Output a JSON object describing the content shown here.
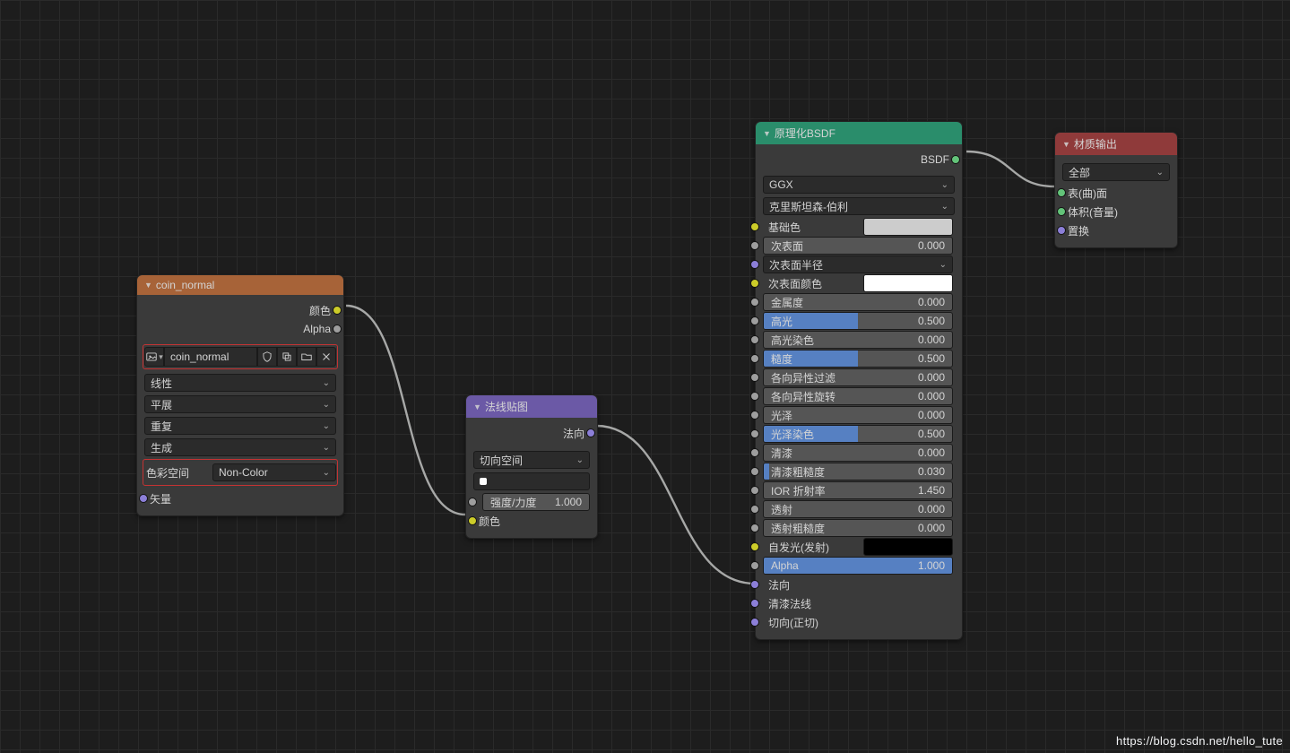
{
  "watermark": "https://blog.csdn.net/hello_tute",
  "imageTexture": {
    "title": "coin_normal",
    "outputs": {
      "color": "颜色",
      "alpha": "Alpha"
    },
    "image_name": "coin_normal",
    "interp": "线性",
    "projection": "平展",
    "extension": "重复",
    "source": "生成",
    "colorspace_label": "色彩空间",
    "colorspace_value": "Non-Color",
    "input_vector": "矢量"
  },
  "normalMap": {
    "title": "法线贴图",
    "output_normal": "法向",
    "space": "切向空间",
    "strength_label": "强度/力度",
    "strength_value": "1.000",
    "input_color": "颜色"
  },
  "bsdf": {
    "title": "原理化BSDF",
    "output": "BSDF",
    "distribution": "GGX",
    "subsurface_method": "克里斯坦森-伯利",
    "rows": [
      {
        "name": "base-color",
        "label": "基础色",
        "type": "swatch",
        "color": "#cccccc",
        "sock": "yellow"
      },
      {
        "name": "subsurface",
        "label": "次表面",
        "type": "value",
        "value": "0.000",
        "fill": 0,
        "sock": "grey"
      },
      {
        "name": "subsurface-radius",
        "label": "次表面半径",
        "type": "dropdown",
        "sock": "purple"
      },
      {
        "name": "subsurface-color",
        "label": "次表面颜色",
        "type": "swatch",
        "color": "#ffffff",
        "sock": "yellow"
      },
      {
        "name": "metallic",
        "label": "金属度",
        "type": "value",
        "value": "0.000",
        "fill": 0,
        "sock": "grey"
      },
      {
        "name": "specular",
        "label": "高光",
        "type": "value",
        "value": "0.500",
        "fill": 50,
        "sock": "grey"
      },
      {
        "name": "specular-tint",
        "label": "高光染色",
        "type": "value",
        "value": "0.000",
        "fill": 0,
        "sock": "grey"
      },
      {
        "name": "roughness",
        "label": "糙度",
        "type": "value",
        "value": "0.500",
        "fill": 50,
        "sock": "grey"
      },
      {
        "name": "anisotropic",
        "label": "各向异性过滤",
        "type": "value",
        "value": "0.000",
        "fill": 0,
        "sock": "grey"
      },
      {
        "name": "anisotropic-rot",
        "label": "各向异性旋转",
        "type": "value",
        "value": "0.000",
        "fill": 0,
        "sock": "grey"
      },
      {
        "name": "sheen",
        "label": "光泽",
        "type": "value",
        "value": "0.000",
        "fill": 0,
        "sock": "grey"
      },
      {
        "name": "sheen-tint",
        "label": "光泽染色",
        "type": "value",
        "value": "0.500",
        "fill": 50,
        "sock": "grey"
      },
      {
        "name": "clearcoat",
        "label": "清漆",
        "type": "value",
        "value": "0.000",
        "fill": 0,
        "sock": "grey"
      },
      {
        "name": "clearcoat-rough",
        "label": "清漆粗糙度",
        "type": "value",
        "value": "0.030",
        "fill": 3,
        "sock": "grey"
      },
      {
        "name": "ior",
        "label": "IOR 折射率",
        "type": "value",
        "value": "1.450",
        "fill": 0,
        "sock": "grey"
      },
      {
        "name": "transmission",
        "label": "透射",
        "type": "value",
        "value": "0.000",
        "fill": 0,
        "sock": "grey"
      },
      {
        "name": "transmission-rough",
        "label": "透射粗糙度",
        "type": "value",
        "value": "0.000",
        "fill": 0,
        "sock": "grey"
      },
      {
        "name": "emission",
        "label": "自发光(发射)",
        "type": "swatch",
        "color": "#000000",
        "sock": "yellow"
      },
      {
        "name": "alpha",
        "label": "Alpha",
        "type": "value",
        "value": "1.000",
        "fill": 100,
        "sock": "grey"
      },
      {
        "name": "normal",
        "label": "法向",
        "type": "input",
        "sock": "purple"
      },
      {
        "name": "clearcoat-normal",
        "label": "清漆法线",
        "type": "input",
        "sock": "purple"
      },
      {
        "name": "tangent",
        "label": "切向(正切)",
        "type": "input",
        "sock": "purple"
      }
    ]
  },
  "output": {
    "title": "材质输出",
    "target": "全部",
    "inputs": {
      "surface": "表(曲)面",
      "volume": "体积(音量)",
      "displacement": "置换"
    }
  }
}
